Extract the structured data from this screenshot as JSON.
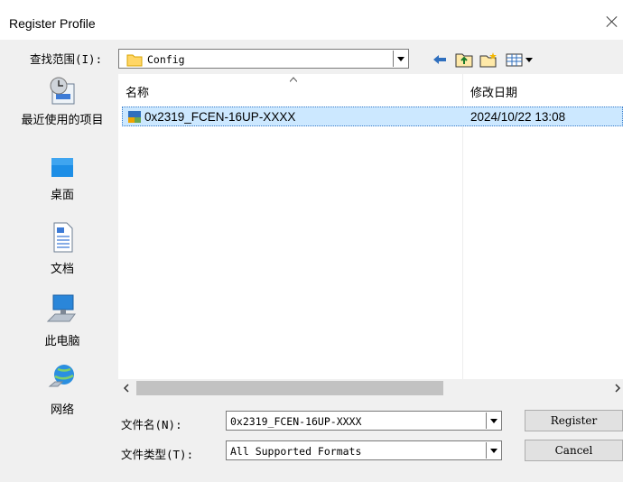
{
  "window": {
    "title": "Register Profile"
  },
  "lookin": {
    "label": "查找范围(I):",
    "value": "Config"
  },
  "places": [
    {
      "label": "最近使用的项目",
      "icon": "recent-places-icon"
    },
    {
      "label": "桌面",
      "icon": "desktop-icon"
    },
    {
      "label": "文档",
      "icon": "documents-icon"
    },
    {
      "label": "此电脑",
      "icon": "this-pc-icon"
    },
    {
      "label": "网络",
      "icon": "network-icon"
    }
  ],
  "list": {
    "col_name": "名称",
    "col_date": "修改日期",
    "files": [
      {
        "name": "0x2319_FCEN-16UP-XXXX",
        "date": "2024/10/22 13:08",
        "icon": "profile-file-icon"
      }
    ]
  },
  "filename": {
    "label": "文件名(N):",
    "value": "0x2319_FCEN-16UP-XXXX"
  },
  "filetype": {
    "label": "文件类型(T):",
    "value": "All Supported Formats"
  },
  "buttons": {
    "register": "Register",
    "cancel": "Cancel"
  },
  "colors": {
    "selection": "#cce8ff",
    "window_bg": "#f0f0f0"
  }
}
